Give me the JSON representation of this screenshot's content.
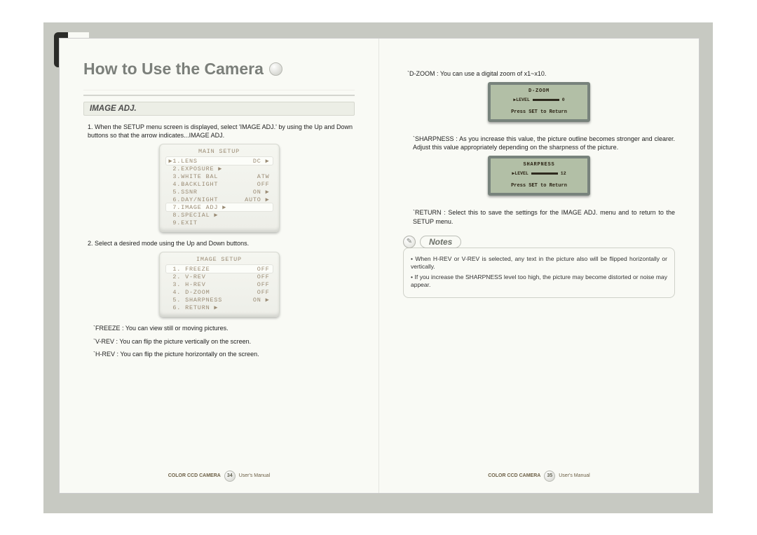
{
  "title": "How to Use the Camera",
  "left": {
    "subheader": "IMAGE ADJ.",
    "step1": "1. When the SETUP menu screen is displayed, select 'IMAGE ADJ.' by using the Up and Down buttons so that the arrow indicates...IMAGE ADJ.",
    "main_setup": {
      "title": "MAIN SETUP",
      "rows": [
        {
          "left": "1.LENS",
          "right": "DC ▶",
          "sel": true,
          "arrow": true
        },
        {
          "left": "2.EXPOSURE ▶",
          "right": ""
        },
        {
          "left": "3.WHITE BAL",
          "right": "ATW"
        },
        {
          "left": "4.BACKLIGHT",
          "right": "OFF"
        },
        {
          "left": "5.SSNR",
          "right": "ON ▶"
        },
        {
          "left": "6.DAY/NIGHT",
          "right": "AUTO ▶"
        },
        {
          "left": "7.IMAGE ADJ ▶",
          "right": "",
          "sel": true
        },
        {
          "left": "8.SPECIAL ▶",
          "right": ""
        },
        {
          "left": "9.EXIT",
          "right": ""
        }
      ]
    },
    "step2": "2. Select a desired mode using the Up and Down buttons.",
    "image_setup": {
      "title": "IMAGE SETUP",
      "rows": [
        {
          "left": "1. FREEZE",
          "right": "OFF",
          "sel": true
        },
        {
          "left": "2. V-REV",
          "right": "OFF"
        },
        {
          "left": "3. H-REV",
          "right": "OFF"
        },
        {
          "left": "4. D-ZOOM",
          "right": "OFF"
        },
        {
          "left": "5. SHARPNESS",
          "right": "ON ▶"
        },
        {
          "left": "6. RETURN ▶",
          "right": ""
        }
      ]
    },
    "freeze": "`FREEZE : You can view still or moving pictures.",
    "vrev": "`V-REV : You can flip the picture vertically on the screen.",
    "hrev": "`H-REV : You can flip the picture horizontally on the screen."
  },
  "right": {
    "dzoom": "`D-ZOOM : You can use a digital zoom of x1~x10.",
    "dzoom_screen": {
      "title": "D-ZOOM",
      "level_label": "▶LEVEL",
      "level_value": "0",
      "return": "Press SET to Return"
    },
    "sharp1": "`SHARPNESS : As you increase this value, the picture outline becomes stronger and clearer. Adjust this value appropriately depending on the sharpness of the picture.",
    "sharp_screen": {
      "title": "SHARPNESS",
      "level_label": "▶LEVEL",
      "level_value": "12",
      "return": "Press SET to Return"
    },
    "return": "`RETURN : Select this to save the settings for the IMAGE ADJ. menu and to return to the SETUP menu.",
    "notes_label": "Notes",
    "notes": [
      "• When H-REV or V-REV is selected, any text in the picture also will be flipped horizontally or vertically.",
      "• If you increase the  SHARPNESS level too high, the picture may become distorted or noise may appear."
    ]
  },
  "footer": {
    "brand": "COLOR CCD CAMERA",
    "manual": "User's Manual",
    "page_left": "34",
    "page_right": "35"
  }
}
